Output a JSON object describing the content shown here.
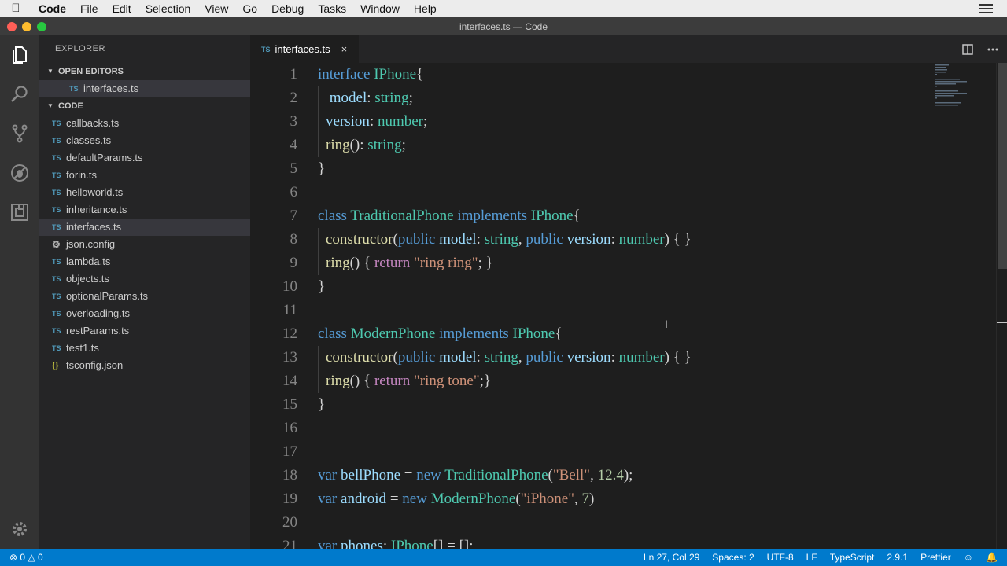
{
  "menubar": {
    "app_name": "Code",
    "items": [
      "File",
      "Edit",
      "Selection",
      "View",
      "Go",
      "Debug",
      "Tasks",
      "Window",
      "Help"
    ]
  },
  "window": {
    "title": "interfaces.ts — Code"
  },
  "activity_bar": {
    "icons": [
      "files-icon",
      "search-icon",
      "source-control-icon",
      "debug-icon",
      "extensions-icon",
      "gear-icon"
    ]
  },
  "sidebar": {
    "header": "EXPLORER",
    "open_editors": {
      "label": "OPEN EDITORS",
      "items": [
        {
          "name": "interfaces.ts",
          "icon": "TS"
        }
      ]
    },
    "folder": {
      "label": "CODE",
      "files": [
        {
          "name": "callbacks.ts",
          "icon": "TS"
        },
        {
          "name": "classes.ts",
          "icon": "TS"
        },
        {
          "name": "defaultParams.ts",
          "icon": "TS"
        },
        {
          "name": "forin.ts",
          "icon": "TS"
        },
        {
          "name": "helloworld.ts",
          "icon": "TS"
        },
        {
          "name": "inheritance.ts",
          "icon": "TS"
        },
        {
          "name": "interfaces.ts",
          "icon": "TS",
          "selected": true
        },
        {
          "name": "json.config",
          "icon": "⚙"
        },
        {
          "name": "lambda.ts",
          "icon": "TS"
        },
        {
          "name": "objects.ts",
          "icon": "TS"
        },
        {
          "name": "optionalParams.ts",
          "icon": "TS"
        },
        {
          "name": "overloading.ts",
          "icon": "TS"
        },
        {
          "name": "restParams.ts",
          "icon": "TS"
        },
        {
          "name": "test1.ts",
          "icon": "TS"
        },
        {
          "name": "tsconfig.json",
          "icon": "{}"
        }
      ]
    }
  },
  "tabs": [
    {
      "label": "interfaces.ts",
      "icon": "TS",
      "active": true,
      "close": "×"
    }
  ],
  "tab_actions": [
    "split-editor-icon",
    "more-actions-icon"
  ],
  "editor": {
    "lines": [
      {
        "n": "1",
        "t": [
          [
            "kw",
            "interface "
          ],
          [
            "ty",
            "IPhone"
          ],
          [
            "pu",
            "{"
          ]
        ]
      },
      {
        "n": "2",
        "t": [
          [
            "gd",
            ""
          ],
          [
            "pu",
            " "
          ],
          [
            "pr",
            "model"
          ],
          [
            "pu",
            ": "
          ],
          [
            "ty",
            "string"
          ],
          [
            "pu",
            ";"
          ]
        ]
      },
      {
        "n": "3",
        "t": [
          [
            "gd",
            ""
          ],
          [
            "pr",
            "version"
          ],
          [
            "pu",
            ": "
          ],
          [
            "ty",
            "number"
          ],
          [
            "pu",
            ";"
          ]
        ]
      },
      {
        "n": "4",
        "t": [
          [
            "gd",
            ""
          ],
          [
            "fn",
            "ring"
          ],
          [
            "pu",
            "(): "
          ],
          [
            "ty",
            "string"
          ],
          [
            "pu",
            ";"
          ]
        ]
      },
      {
        "n": "5",
        "t": [
          [
            "pu",
            "}"
          ]
        ]
      },
      {
        "n": "6",
        "t": []
      },
      {
        "n": "7",
        "t": [
          [
            "kw",
            "class "
          ],
          [
            "ty",
            "TraditionalPhone "
          ],
          [
            "kw",
            "implements "
          ],
          [
            "ty",
            "IPhone"
          ],
          [
            "pu",
            "{"
          ]
        ]
      },
      {
        "n": "8",
        "t": [
          [
            "gd",
            ""
          ],
          [
            "fn",
            "constructor"
          ],
          [
            "pu",
            "("
          ],
          [
            "kw",
            "public "
          ],
          [
            "pr",
            "model"
          ],
          [
            "pu",
            ": "
          ],
          [
            "ty",
            "string"
          ],
          [
            "pu",
            ", "
          ],
          [
            "kw",
            "public "
          ],
          [
            "pr",
            "version"
          ],
          [
            "pu",
            ": "
          ],
          [
            "ty",
            "number"
          ],
          [
            "pu",
            ") { }"
          ]
        ]
      },
      {
        "n": "9",
        "t": [
          [
            "gd",
            ""
          ],
          [
            "fn",
            "ring"
          ],
          [
            "pu",
            "() { "
          ],
          [
            "ct",
            "return "
          ],
          [
            "st",
            "\"ring ring\""
          ],
          [
            "pu",
            "; }"
          ]
        ]
      },
      {
        "n": "10",
        "t": [
          [
            "pu",
            "}"
          ]
        ]
      },
      {
        "n": "11",
        "t": []
      },
      {
        "n": "12",
        "t": [
          [
            "kw",
            "class "
          ],
          [
            "ty",
            "ModernPhone "
          ],
          [
            "kw",
            "implements "
          ],
          [
            "ty",
            "IPhone"
          ],
          [
            "pu",
            "{"
          ]
        ]
      },
      {
        "n": "13",
        "t": [
          [
            "gd",
            ""
          ],
          [
            "fn",
            "constructor"
          ],
          [
            "pu",
            "("
          ],
          [
            "kw",
            "public "
          ],
          [
            "pr",
            "model"
          ],
          [
            "pu",
            ": "
          ],
          [
            "ty",
            "string"
          ],
          [
            "pu",
            ", "
          ],
          [
            "kw",
            "public "
          ],
          [
            "pr",
            "version"
          ],
          [
            "pu",
            ": "
          ],
          [
            "ty",
            "number"
          ],
          [
            "pu",
            ") { }"
          ]
        ]
      },
      {
        "n": "14",
        "t": [
          [
            "gd",
            ""
          ],
          [
            "fn",
            "ring"
          ],
          [
            "pu",
            "() { "
          ],
          [
            "ct",
            "return "
          ],
          [
            "st",
            "\"ring tone\""
          ],
          [
            "pu",
            ";}"
          ]
        ]
      },
      {
        "n": "15",
        "t": [
          [
            "pu",
            "}"
          ]
        ]
      },
      {
        "n": "16",
        "t": []
      },
      {
        "n": "17",
        "t": []
      },
      {
        "n": "18",
        "t": [
          [
            "kw",
            "var "
          ],
          [
            "pr",
            "bellPhone"
          ],
          [
            "pu",
            " = "
          ],
          [
            "kw",
            "new "
          ],
          [
            "ty",
            "TraditionalPhone"
          ],
          [
            "pu",
            "("
          ],
          [
            "st",
            "\"Bell\""
          ],
          [
            "pu",
            ", "
          ],
          [
            "nu",
            "12.4"
          ],
          [
            "pu",
            ");"
          ]
        ]
      },
      {
        "n": "19",
        "t": [
          [
            "kw",
            "var "
          ],
          [
            "pr",
            "android"
          ],
          [
            "pu",
            " = "
          ],
          [
            "kw",
            "new "
          ],
          [
            "ty",
            "ModernPhone"
          ],
          [
            "pu",
            "("
          ],
          [
            "st",
            "\"iPhone\""
          ],
          [
            "pu",
            ", "
          ],
          [
            "nu",
            "7"
          ],
          [
            "pu",
            ")"
          ]
        ]
      },
      {
        "n": "20",
        "t": []
      },
      {
        "n": "21",
        "t": [
          [
            "kw",
            "var "
          ],
          [
            "pr",
            "phones"
          ],
          [
            "pu",
            ": "
          ],
          [
            "ty",
            "IPhone"
          ],
          [
            "pu",
            "[] = [];"
          ]
        ]
      }
    ]
  },
  "statusbar": {
    "errors": "0",
    "warnings": "0",
    "position": "Ln 27, Col 29",
    "spaces": "Spaces: 2",
    "encoding": "UTF-8",
    "eol": "LF",
    "language": "TypeScript",
    "version": "2.9.1",
    "formatter": "Prettier"
  },
  "colors": {
    "statusbar": "#007acc",
    "keyword": "#569cd6",
    "type": "#4ec9b0",
    "string": "#ce9178",
    "number": "#b5cea8"
  }
}
